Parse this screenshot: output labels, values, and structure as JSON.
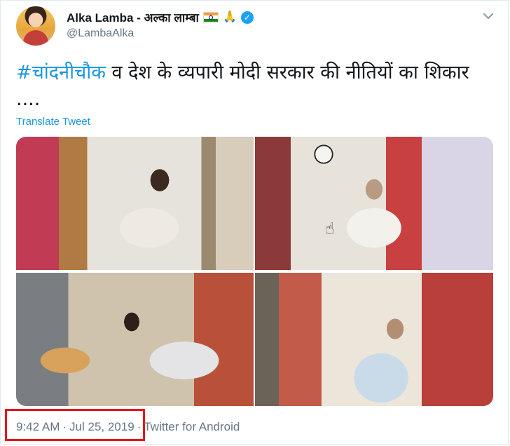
{
  "tweet": {
    "display_name": "Alka Lamba - अल्का लाम्बा",
    "emoji_flag": "india-flag-icon",
    "emoji_pray": "🙏",
    "handle": "@LambaAlka",
    "hashtag": "#चांदनीचौक",
    "text_rest": " व देश के व्यपारी मोदी सरकार की नीतियों का शिकार ....",
    "translate_label": "Translate Tweet",
    "time": "9:42 AM",
    "date": "Jul 25, 2019",
    "source": "Twitter for Android",
    "separator": "·"
  },
  "colors": {
    "accent": "#1b95e0",
    "verified": "#1da1f2",
    "highlight_box": "#e8141b",
    "muted": "#657786"
  }
}
